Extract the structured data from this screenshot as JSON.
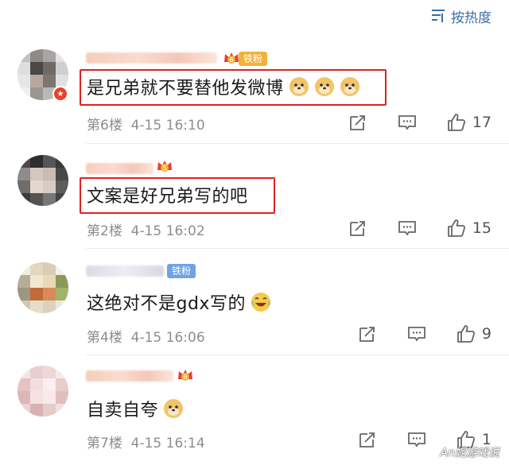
{
  "sort": {
    "label": "按热度"
  },
  "comments": [
    {
      "text": "是兄弟就不要替他发微博",
      "emoji_count": 3,
      "floor": "第6楼",
      "date": "4-15",
      "time": "16:10",
      "likes": "17",
      "badge": "铁粉",
      "crown_level": "6"
    },
    {
      "text": "文案是好兄弟写的吧",
      "emoji_count": 0,
      "floor": "第2楼",
      "date": "4-15",
      "time": "16:02",
      "likes": "15",
      "crown_level": "5"
    },
    {
      "text": "这绝对不是gdx写的",
      "emoji_count": 1,
      "floor": "第4楼",
      "date": "4-15",
      "time": "16:06",
      "likes": "9",
      "badge": "铁粉"
    },
    {
      "text": "自卖自夸",
      "emoji_count": 1,
      "floor": "第7楼",
      "date": "4-15",
      "time": "16:14",
      "likes": "1",
      "crown_level": "6"
    }
  ],
  "icons": [
    "sort-icon",
    "share-icon",
    "comment-icon",
    "like-icon",
    "doge-emoji",
    "laugh-cry-emoji",
    "crown-icon"
  ],
  "colors": {
    "accent": "#3a6ea5",
    "highlight": "#e02020",
    "gold_badge": "#f0b23a",
    "blue_badge": "#6fa3e0",
    "meta": "#8d8d8d"
  },
  "watermark": "An妮游戏说"
}
